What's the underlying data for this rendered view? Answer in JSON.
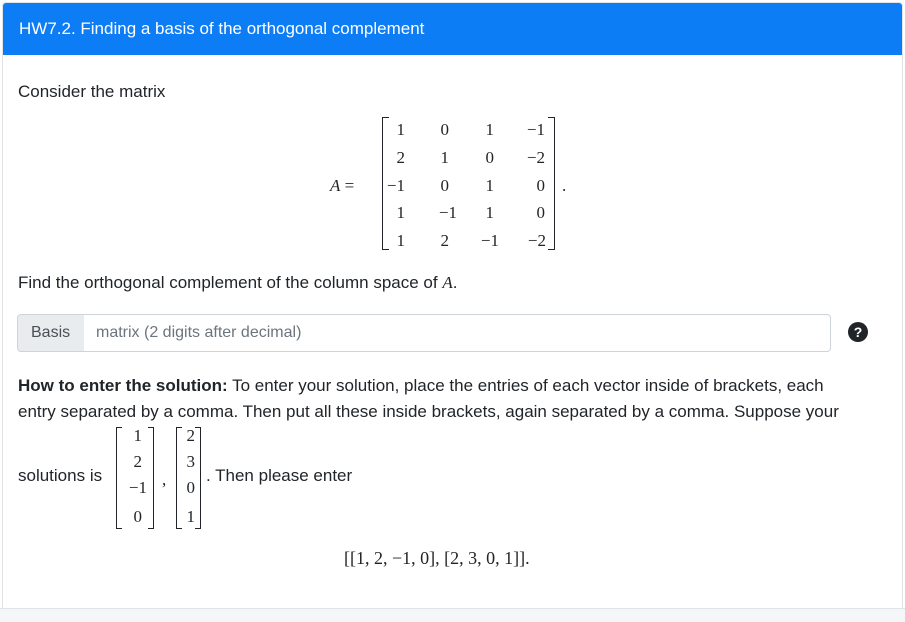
{
  "header": {
    "title": "HW7.2. Finding a basis of the orthogonal complement"
  },
  "intro": "Consider the matrix",
  "matrix": {
    "lhs": "A =",
    "rows": [
      [
        "1",
        "0",
        "1",
        "−1"
      ],
      [
        "2",
        "1",
        "0",
        "−2"
      ],
      [
        "−1",
        "0",
        "1",
        "0"
      ],
      [
        "1",
        "−1",
        "1",
        "0"
      ],
      [
        "1",
        "2",
        "−1",
        "−2"
      ]
    ],
    "trailing": "."
  },
  "question": {
    "prefix": "Find the orthogonal complement of the column space of ",
    "var": "A",
    "suffix": "."
  },
  "answer": {
    "addon_label": "Basis",
    "placeholder": "matrix (2 digits after decimal)",
    "help_icon": "question-circle-icon",
    "help_glyph": "?"
  },
  "instructions": {
    "bold": "How to enter the solution:",
    "line1": " To enter your solution, place the entries of each vector inside of brackets, each",
    "line2": "entry separated by a comma. Then put all these inside brackets, again separated by a comma. Suppose your",
    "solutions_is": "solutions is",
    "vector1": [
      "1",
      "2",
      "−1",
      "0"
    ],
    "vector2": [
      "2",
      "3",
      "0",
      "1"
    ],
    "comma": ",",
    "then_enter": ". Then please enter",
    "example": "[[1, 2, −1, 0], [2, 3, 0, 1]]."
  }
}
